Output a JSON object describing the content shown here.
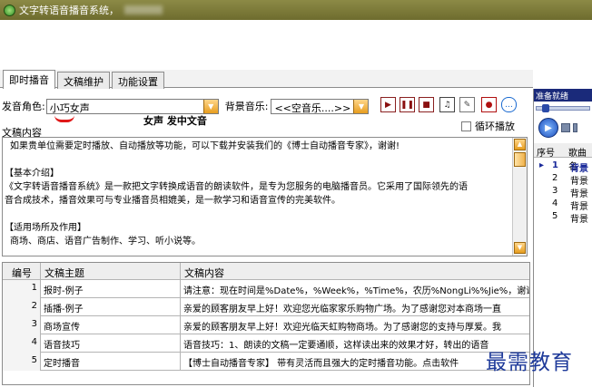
{
  "window": {
    "title": "文字转语音播音系统，"
  },
  "tabs": [
    {
      "label": "即时播音"
    },
    {
      "label": "文稿维护"
    },
    {
      "label": "功能设置"
    }
  ],
  "voice": {
    "label": "发音角色:",
    "value": "小巧女声",
    "type_label": "女声  发中文音"
  },
  "music": {
    "label": "背景音乐:",
    "value": "<<空音乐....>>"
  },
  "loop": {
    "label": "循环播放",
    "checked": false
  },
  "content": {
    "label": "文稿内容",
    "lines": [
      "如果贵单位需要定时播放、自动播放等功能，可以下载并安装我们的《博士自动播音专家》，谢谢!",
      "",
      "【基本介绍】",
      "《文字转语音播音系统》是一款把文字转换成语音的朗读软件，是专为您服务的电脑播音员。它采用了国际领先的语",
      "音合成技术，播音效果可与专业播音员相媲美，是一款学习和语音宣传的完美软件。",
      "",
      "【适用场所及作用】",
      "商场、商店、语音广告制作、学习、听小说等。"
    ]
  },
  "grid": {
    "headers": [
      "编号",
      "文稿主题",
      "文稿内容"
    ],
    "rows": [
      {
        "id": "1",
        "title": "报时-例子",
        "content": "请注意：现在时间是%Date%，%Week%，%Time%，农历%NongLi%%Jie%，谢谢您的"
      },
      {
        "id": "2",
        "title": "插播-例子",
        "content": "亲爱的顾客朋友早上好！欢迎您光临家家乐购物广场。为了感谢您对本商场一直"
      },
      {
        "id": "3",
        "title": "商场宣传",
        "content": "亲爱的顾客朋友早上好！欢迎光临天虹购物商场。为了感谢您的支持与厚爱。我"
      },
      {
        "id": "4",
        "title": "语音技巧",
        "content": "语音技巧：1、朗读的文稿一定要通顺，这样读出来的效果才好，转出的语音"
      },
      {
        "id": "5",
        "title": "定时播音",
        "content": "【博士自动播音专家】  带有灵活而且强大的定时播音功能。点击软件"
      }
    ]
  },
  "playlist": {
    "status": "准备就绪",
    "headers": [
      "序号",
      "歌曲名"
    ],
    "rows": [
      {
        "no": "1",
        "name": "背景",
        "current": true
      },
      {
        "no": "2",
        "name": "背景"
      },
      {
        "no": "3",
        "name": "背景"
      },
      {
        "no": "4",
        "name": "背景"
      },
      {
        "no": "5",
        "name": "背景"
      }
    ]
  },
  "watermark": "最需教育",
  "colors": {
    "titlebar": "#7c7a3a",
    "accent": "#e79d1e",
    "playlist_status": "#1a2a7a",
    "watermark": "#1e3a9a"
  }
}
